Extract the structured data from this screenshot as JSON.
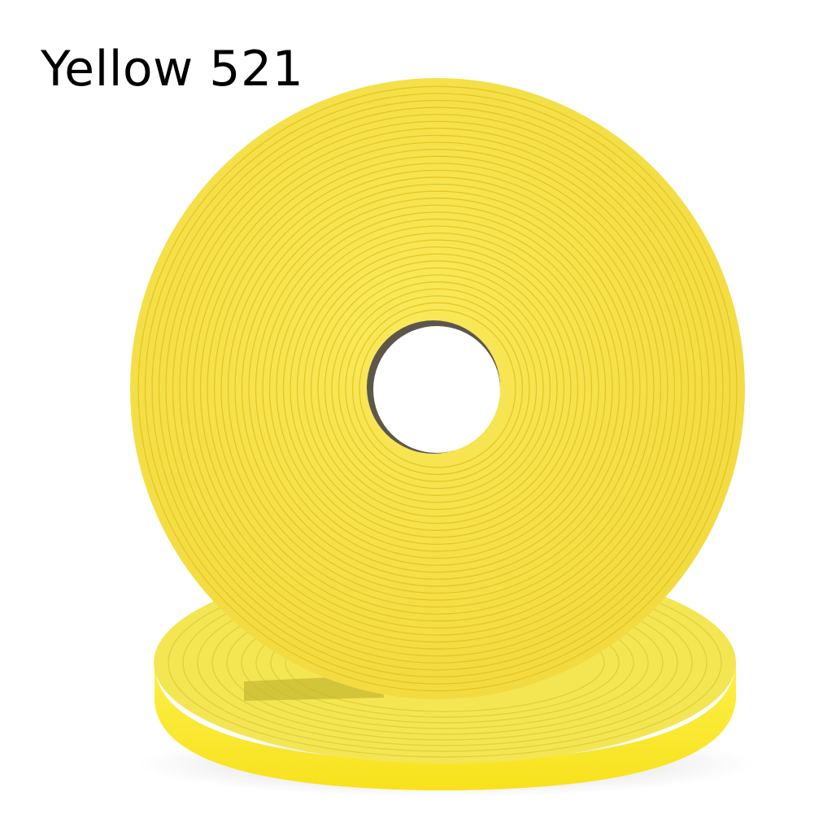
{
  "caption": {
    "text": "Yellow 521"
  },
  "product": {
    "subject": "roll-of-yellow-webbing",
    "colors": {
      "face": "#f5e048",
      "face_light": "#f9e95a",
      "ring_line": "#e3c21c",
      "flat_roll_top": "#f4e652",
      "flat_roll_side": "#fbe829",
      "hole": "#ffffff",
      "hole_edge": "#5c574a",
      "shadow": "#c4b630"
    }
  }
}
